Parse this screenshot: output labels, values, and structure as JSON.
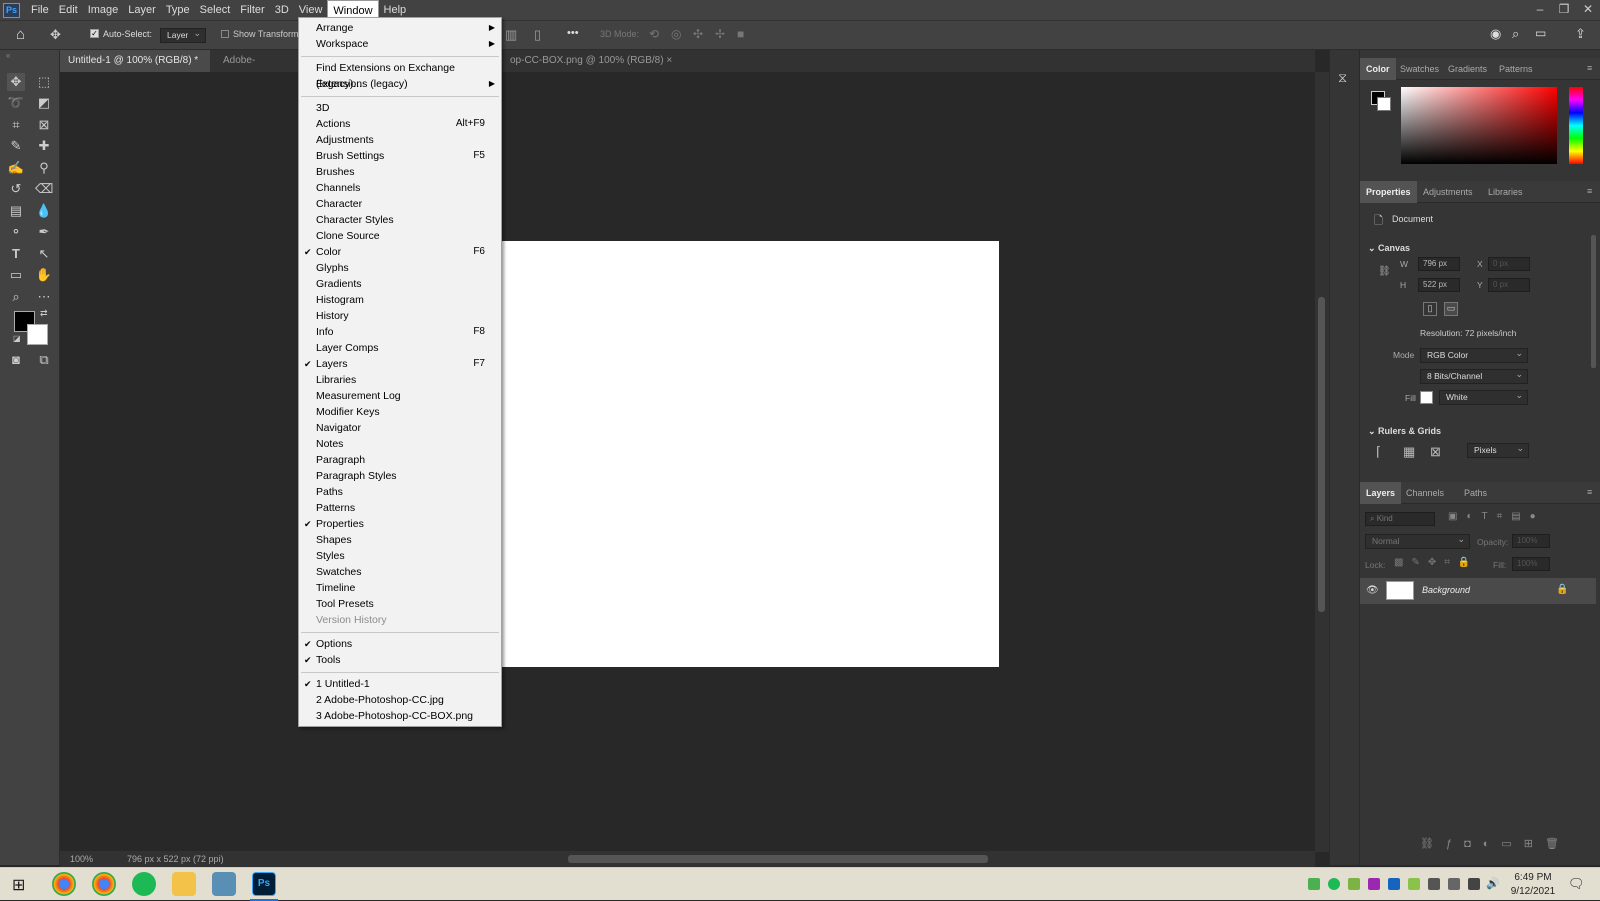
{
  "app": {
    "logo": "Ps"
  },
  "menubar": {
    "items": [
      "File",
      "Edit",
      "Image",
      "Layer",
      "Type",
      "Select",
      "Filter",
      "3D",
      "View",
      "Window",
      "Help"
    ],
    "active": "Window"
  },
  "window_controls": {
    "minimize": "–",
    "restore": "❐",
    "close": "✕"
  },
  "options_bar": {
    "auto_select_label": "Auto-Select:",
    "auto_select_target": "Layer",
    "show_transform": "Show Transform",
    "mode_3d": "3D Mode:",
    "more": "•••"
  },
  "tabs": [
    {
      "label": "Untitled-1 @ 100% (RGB/8) *",
      "close": "×"
    },
    {
      "label": "Adobe-Photosho",
      "close": ""
    },
    {
      "label": "op-CC-BOX.png @ 100% (RGB/8)",
      "close": "×"
    }
  ],
  "window_menu": {
    "group1": [
      {
        "label": "Arrange",
        "submenu": true
      },
      {
        "label": "Workspace",
        "submenu": true
      }
    ],
    "group2": [
      {
        "label": "Find Extensions on Exchange (legacy)...",
        "submenu": false
      },
      {
        "label": "Extensions (legacy)",
        "submenu": true
      }
    ],
    "group3": [
      {
        "label": "3D",
        "shortcut": "",
        "checked": false,
        "disabled": false
      },
      {
        "label": "Actions",
        "shortcut": "Alt+F9",
        "checked": false,
        "disabled": false
      },
      {
        "label": "Adjustments",
        "shortcut": "",
        "checked": false,
        "disabled": false
      },
      {
        "label": "Brush Settings",
        "shortcut": "F5",
        "checked": false,
        "disabled": false
      },
      {
        "label": "Brushes",
        "shortcut": "",
        "checked": false,
        "disabled": false
      },
      {
        "label": "Channels",
        "shortcut": "",
        "checked": false,
        "disabled": false
      },
      {
        "label": "Character",
        "shortcut": "",
        "checked": false,
        "disabled": false
      },
      {
        "label": "Character Styles",
        "shortcut": "",
        "checked": false,
        "disabled": false
      },
      {
        "label": "Clone Source",
        "shortcut": "",
        "checked": false,
        "disabled": false
      },
      {
        "label": "Color",
        "shortcut": "F6",
        "checked": true,
        "disabled": false
      },
      {
        "label": "Glyphs",
        "shortcut": "",
        "checked": false,
        "disabled": false
      },
      {
        "label": "Gradients",
        "shortcut": "",
        "checked": false,
        "disabled": false
      },
      {
        "label": "Histogram",
        "shortcut": "",
        "checked": false,
        "disabled": false
      },
      {
        "label": "History",
        "shortcut": "",
        "checked": false,
        "disabled": false
      },
      {
        "label": "Info",
        "shortcut": "F8",
        "checked": false,
        "disabled": false
      },
      {
        "label": "Layer Comps",
        "shortcut": "",
        "checked": false,
        "disabled": false
      },
      {
        "label": "Layers",
        "shortcut": "F7",
        "checked": true,
        "disabled": false
      },
      {
        "label": "Libraries",
        "shortcut": "",
        "checked": false,
        "disabled": false
      },
      {
        "label": "Measurement Log",
        "shortcut": "",
        "checked": false,
        "disabled": false
      },
      {
        "label": "Modifier Keys",
        "shortcut": "",
        "checked": false,
        "disabled": false
      },
      {
        "label": "Navigator",
        "shortcut": "",
        "checked": false,
        "disabled": false
      },
      {
        "label": "Notes",
        "shortcut": "",
        "checked": false,
        "disabled": false
      },
      {
        "label": "Paragraph",
        "shortcut": "",
        "checked": false,
        "disabled": false
      },
      {
        "label": "Paragraph Styles",
        "shortcut": "",
        "checked": false,
        "disabled": false
      },
      {
        "label": "Paths",
        "shortcut": "",
        "checked": false,
        "disabled": false
      },
      {
        "label": "Patterns",
        "shortcut": "",
        "checked": false,
        "disabled": false
      },
      {
        "label": "Properties",
        "shortcut": "",
        "checked": true,
        "disabled": false
      },
      {
        "label": "Shapes",
        "shortcut": "",
        "checked": false,
        "disabled": false
      },
      {
        "label": "Styles",
        "shortcut": "",
        "checked": false,
        "disabled": false
      },
      {
        "label": "Swatches",
        "shortcut": "",
        "checked": false,
        "disabled": false
      },
      {
        "label": "Timeline",
        "shortcut": "",
        "checked": false,
        "disabled": false
      },
      {
        "label": "Tool Presets",
        "shortcut": "",
        "checked": false,
        "disabled": false
      },
      {
        "label": "Version History",
        "shortcut": "",
        "checked": false,
        "disabled": true
      }
    ],
    "group4": [
      {
        "label": "Options",
        "checked": true
      },
      {
        "label": "Tools",
        "checked": true
      }
    ],
    "group5": [
      {
        "label": "1 Untitled-1",
        "checked": true
      },
      {
        "label": "2 Adobe-Photoshop-CC.jpg",
        "checked": false
      },
      {
        "label": "3 Adobe-Photoshop-CC-BOX.png",
        "checked": false
      }
    ]
  },
  "color_panel": {
    "tabs": [
      "Color",
      "Swatches",
      "Gradients",
      "Patterns"
    ],
    "active": "Color"
  },
  "properties_panel": {
    "tabs": [
      "Properties",
      "Adjustments",
      "Libraries"
    ],
    "active": "Properties",
    "doc_label": "Document",
    "canvas_title": "Canvas",
    "w_label": "W",
    "w_value": "796 px",
    "h_label": "H",
    "h_value": "522 px",
    "x_label": "X",
    "x_value": "0 px",
    "y_label": "Y",
    "y_value": "0 px",
    "resolution": "Resolution: 72 pixels/inch",
    "mode_label": "Mode",
    "mode_value": "RGB Color",
    "bits_value": "8 Bits/Channel",
    "fill_label": "Fill",
    "fill_value": "White",
    "rulers_title": "Rulers & Grids",
    "units_value": "Pixels"
  },
  "layers_panel": {
    "tabs": [
      "Layers",
      "Channels",
      "Paths"
    ],
    "active": "Layers",
    "kind_placeholder": "Kind",
    "blend_mode": "Normal",
    "opacity_label": "Opacity:",
    "opacity_value": "100%",
    "lock_label": "Lock:",
    "fill_label": "Fill:",
    "fill_value": "100%",
    "layers": [
      {
        "name": "Background"
      }
    ]
  },
  "status": {
    "zoom": "100%",
    "doc_info": "796 px x 522 px (72 ppi)"
  },
  "taskbar": {
    "time": "6:49 PM",
    "date": "9/12/2021"
  },
  "colors": {
    "menu_bg": "#f2f2f2",
    "panel_bg": "#353535",
    "workspace": "#282828",
    "accent": "#31a8ff"
  }
}
